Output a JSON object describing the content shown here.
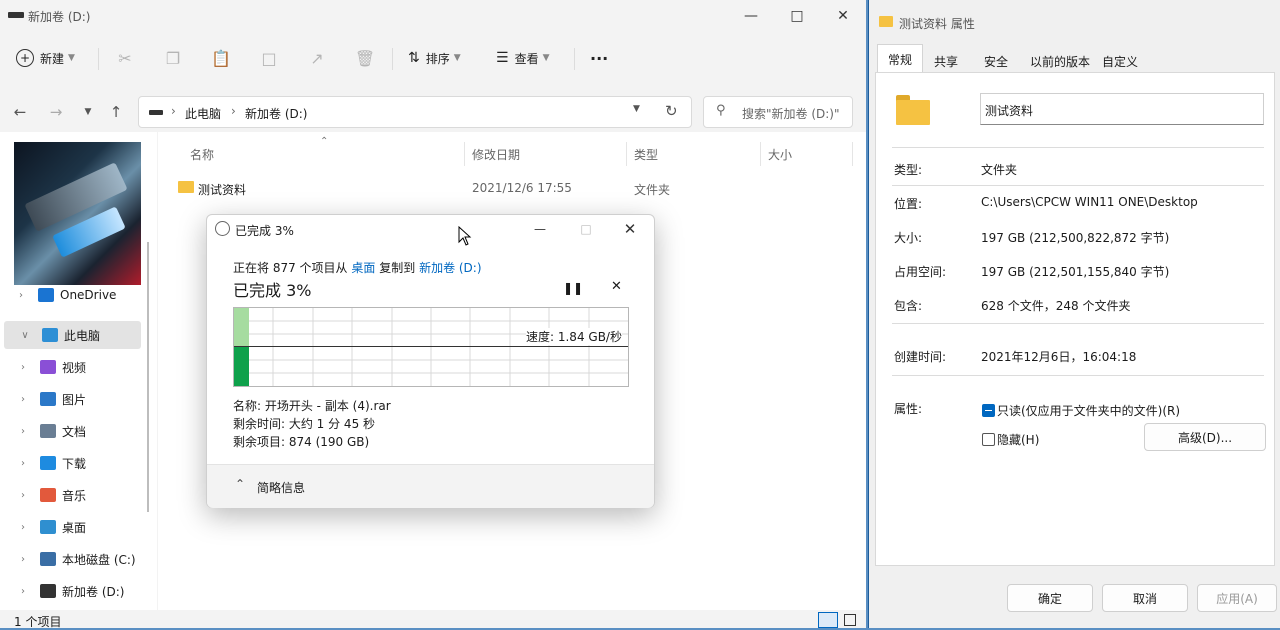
{
  "explorer": {
    "window_title": "新加卷 (D:)",
    "toolbar": {
      "new_label": "新建",
      "sort_label": "排序",
      "view_label": "查看",
      "more_label": "···"
    },
    "breadcrumb": [
      "此电脑",
      "新加卷 (D:)"
    ],
    "search_placeholder": "搜索\"新加卷 (D:)\"",
    "columns": [
      "名称",
      "修改日期",
      "类型",
      "大小"
    ],
    "files": [
      {
        "name": "测试资料",
        "modified": "2021/12/6 17:55",
        "type": "文件夹",
        "size": ""
      }
    ],
    "nav_items": [
      {
        "label": "OneDrive",
        "icon": "cloud-icon",
        "color": "#1a74d2"
      },
      {
        "label": "此电脑",
        "icon": "pc-icon",
        "color": "#2d8fd5"
      },
      {
        "label": "视频",
        "icon": "video-icon",
        "color": "#8a4fd6"
      },
      {
        "label": "图片",
        "icon": "picture-icon",
        "color": "#2b78c8"
      },
      {
        "label": "文档",
        "icon": "document-icon",
        "color": "#6a7e94"
      },
      {
        "label": "下载",
        "icon": "download-icon",
        "color": "#1e8be0"
      },
      {
        "label": "音乐",
        "icon": "music-icon",
        "color": "#e2593c"
      },
      {
        "label": "桌面",
        "icon": "desktop-icon",
        "color": "#2f8fd0"
      },
      {
        "label": "本地磁盘 (C:)",
        "icon": "drive-c-icon",
        "color": "#3a6ea5"
      },
      {
        "label": "新加卷 (D:)",
        "icon": "drive-d-icon",
        "color": "#333333"
      }
    ],
    "status": "1 个项目"
  },
  "copy_dialog": {
    "title": "已完成 3%",
    "line1_prefix": "正在将 877 个项目从",
    "from": "桌面",
    "mid": "复制到",
    "to": "新加卷 (D:)",
    "heading": "已完成 3%",
    "progress": 0.03,
    "speed": "速度: 1.84 GB/秒",
    "name": "名称: 开场开头 - 副本 (4).rar",
    "time_left": "剩余时间: 大约 1 分 45 秒",
    "items_left": "剩余项目: 874 (190 GB)",
    "less_details": "简略信息"
  },
  "properties": {
    "window_title": "测试资料 属性",
    "tabs": [
      "常规",
      "共享",
      "安全",
      "以前的版本",
      "自定义"
    ],
    "active_tab": "常规",
    "folder_name": "测试资料",
    "rows": [
      {
        "label": "类型:",
        "value": "文件夹"
      },
      {
        "label": "位置:",
        "value": "C:\\Users\\CPCW WIN11 ONE\\Desktop"
      },
      {
        "label": "大小:",
        "value": "197 GB (212,500,822,872 字节)"
      },
      {
        "label": "占用空间:",
        "value": "197 GB (212,501,155,840 字节)"
      },
      {
        "label": "包含:",
        "value": "628 个文件，248 个文件夹"
      },
      {
        "label": "创建时间:",
        "value": "2021年12月6日，16:04:18"
      },
      {
        "label": "属性:",
        "value": ""
      }
    ],
    "readonly_label": "只读(仅应用于文件夹中的文件)(R)",
    "hidden_label": "隐藏(H)",
    "advanced_button": "高级(D)...",
    "ok_button": "确定",
    "cancel_button": "取消",
    "apply_button": "应用(A)"
  }
}
